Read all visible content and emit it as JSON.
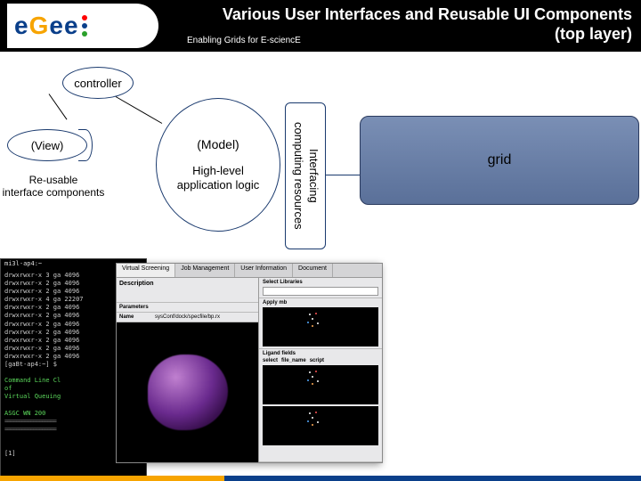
{
  "header": {
    "logo_text_parts": [
      "e",
      "g",
      "e",
      "e"
    ],
    "title_line1": "Various User Interfaces and Reusable UI Components",
    "title_line2": "(top layer)",
    "tagline": "Enabling Grids for E-sciencE"
  },
  "diagram": {
    "controller": "controller",
    "view": "(View)",
    "reusable_line1": "Re-usable",
    "reusable_line2": "interface components",
    "model": "(Model)",
    "highlevel_line1": "High-level",
    "highlevel_line2": "application logic",
    "interfacing_line1": "Interfacing",
    "interfacing_line2": "computing resources",
    "grid": "grid"
  },
  "terminal": {
    "title": "mi3l-ap4:~",
    "lines": [
      "drwxrwxr-x   3 ga   4096",
      "drwxrwxr-x   2 ga   4096",
      "drwxrwxr-x   2 ga   4096",
      "drwxrwxr-x   4 ga  22207",
      "drwxrwxr-x   2 ga   4096",
      "drwxrwxr-x   2 ga   4096",
      "drwxrwxr-x   2 ga   4096",
      "drwxrwxr-x   2 ga   4096",
      "drwxrwxr-x   2 ga   4096",
      "drwxrwxr-x   2 ga   4096",
      "drwxrwxr-x   2 ga   4096",
      "[gaBt-ap4:~] $"
    ],
    "highlight1": "Command Line Cl",
    "highlight2": "Virtual Queuing",
    "highlight3": "ASGC WN 200",
    "eqline": "==================",
    "footer": "[1]"
  },
  "app": {
    "tabs": [
      "Virtual Screening",
      "Job Management",
      "User Information",
      "Document"
    ],
    "desc_label": "Description",
    "param_label": "Parameters",
    "param_name": "Name",
    "param_value": "sysConf/dock/specfile/bp.rx",
    "right_sec1": "Select Libraries",
    "right_sec2": "Apply mb",
    "right_sec3": "Ligand fields",
    "ligand_cols": [
      "select",
      "file_name",
      "script"
    ]
  }
}
